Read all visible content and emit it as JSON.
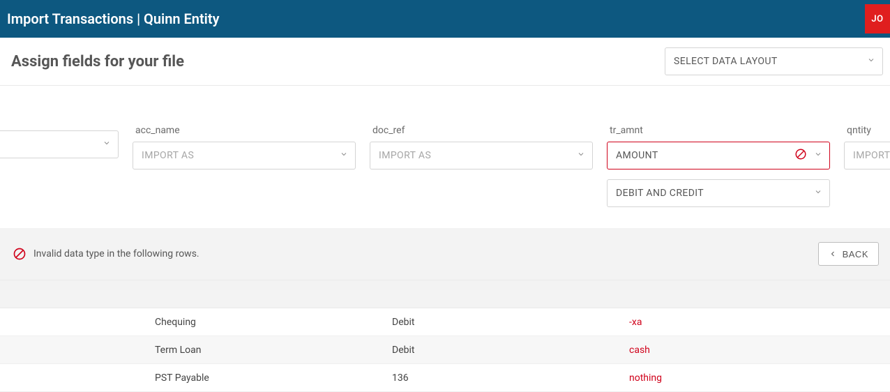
{
  "header": {
    "title": "Import Transactions | Quinn Entity",
    "avatar": "JO"
  },
  "subheader": {
    "title": "Assign fields for your file",
    "layout_select": "SELECT DATA LAYOUT"
  },
  "columns": {
    "pre": {
      "label": "",
      "value": ""
    },
    "acc_name": {
      "label": "acc_name",
      "value": "IMPORT AS"
    },
    "doc_ref": {
      "label": "doc_ref",
      "value": "IMPORT AS"
    },
    "tr_amnt": {
      "label": "tr_amnt",
      "value": "AMOUNT",
      "secondary": "DEBIT AND CREDIT"
    },
    "qntity": {
      "label": "qntity",
      "value": "IMPORT AS"
    }
  },
  "status": {
    "message": "Invalid data type in the following rows.",
    "back": "BACK"
  },
  "rows": [
    {
      "acc_name": "Chequing",
      "doc_ref": "Debit",
      "tr_amnt": "-xa"
    },
    {
      "acc_name": "Term Loan",
      "doc_ref": "Debit",
      "tr_amnt": "cash"
    },
    {
      "acc_name": "PST Payable",
      "doc_ref": "136",
      "tr_amnt": "nothing"
    }
  ]
}
